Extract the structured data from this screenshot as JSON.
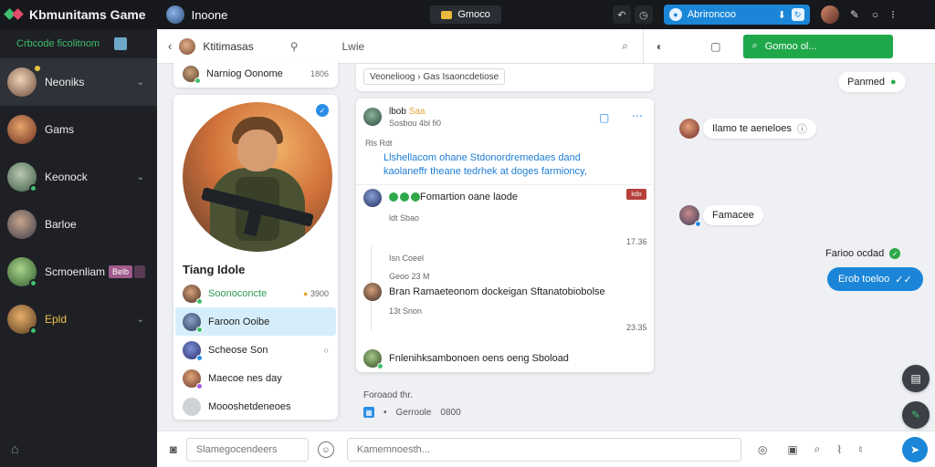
{
  "topbar": {
    "app_title": "Kbmunitams Game",
    "workspace": "Inoone",
    "tab_label": "Gmoco",
    "notify_label": "Abrironcoo",
    "colors": {
      "bg": "#16181c",
      "accent": "#1b86d8"
    }
  },
  "sidebar": {
    "header_label": "Crbcode ficolitnom",
    "items": [
      {
        "name": "Neoniks",
        "active": true
      },
      {
        "name": "Gams"
      },
      {
        "name": "Keonock"
      },
      {
        "name": "Barloe"
      },
      {
        "name": "Scmoenliam",
        "badge": "Belb"
      },
      {
        "name": "Epld"
      }
    ]
  },
  "chat_header": {
    "name": "Ktitimasas",
    "title": "Lwie",
    "cta_label": "Gomoo ol..."
  },
  "left_column": {
    "mini_card": {
      "name": "Narniog Oonome",
      "count": "1806"
    },
    "profile_title": "Tiang Idole",
    "rows": [
      {
        "name": "Soonoconcte",
        "right": "3900",
        "green": true
      },
      {
        "name": "Faroon Ooibe",
        "selected": true
      },
      {
        "name": "Scheose Son",
        "right": "○"
      },
      {
        "name": "Maecoe nes day"
      },
      {
        "name": "Moooshetdeneoes"
      }
    ]
  },
  "feed": {
    "top_tag": "Veonelioog › Gas Isaoncdetiose",
    "thread": {
      "author": "lbob",
      "author_tag": "Saa",
      "subtitle": "Sosbou 4bl fi0",
      "meta": "Rls Rdt",
      "link_line1": "Llshellacom ohane Stdonordremedaes dand",
      "link_line2": "kaolaneffr theane tedrhek at doges farmioncy,",
      "reply1_text": "Fomartion oane laode",
      "reply1_badge": "kdo",
      "reply1_meta": "ldt Sbao",
      "time1": "17.36",
      "reply2_meta": "Isn Coeel",
      "reply2_sub": "Geoo 23 M",
      "reply2_text": "Bran Ramaeteonom dockeigan Sftanatobiobolse",
      "reply2_meta2": "13t Snon",
      "time2": "23.35",
      "reply3_text": "Fnlenihksambonoen oens oeng Sboload"
    },
    "bottom_label": "Foroaod thr.",
    "bottom_meta": "Gerroole",
    "bottom_count": "0800"
  },
  "right_chat": {
    "msg1": "Ilamo te aeneloes",
    "msg2": "Famacee",
    "status_chip": "Panmed",
    "status_text": "Farioo ocdad",
    "bubble": "Erob toeloo"
  },
  "composer": {
    "placeholder_left": "Slamegocendeers",
    "placeholder_main": "Kamemnoesth..."
  },
  "icons": [
    "logo-icon",
    "back-icon",
    "search-icon",
    "mic-icon",
    "folder-icon",
    "camera-icon",
    "emoji-icon",
    "send-icon",
    "home-icon"
  ]
}
